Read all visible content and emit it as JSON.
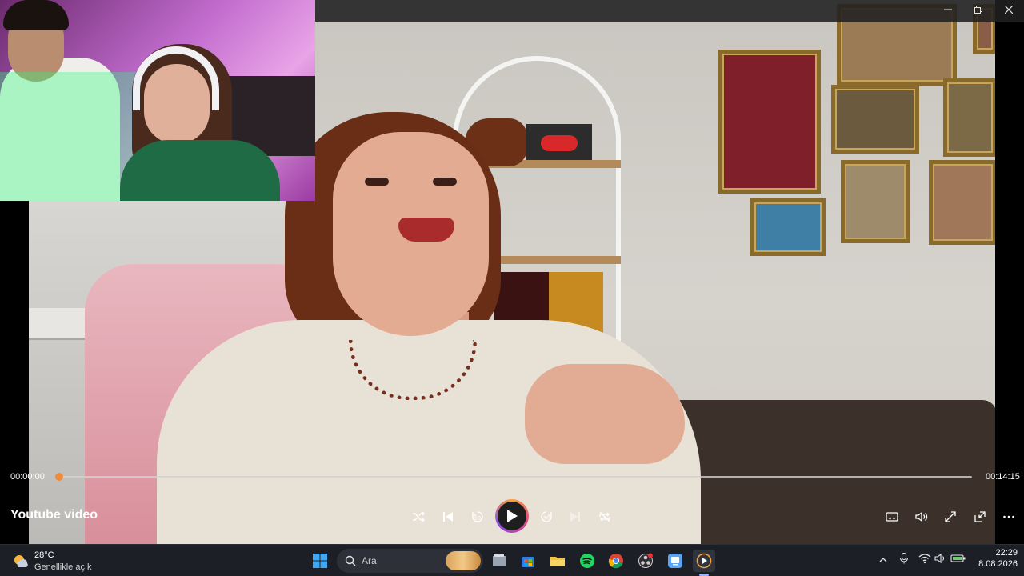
{
  "player": {
    "title": "Youtube video",
    "elapsed": "00:00:00",
    "duration": "00:14:15",
    "progress": 0.0,
    "accent_color": "#f08a3c",
    "controls": [
      "shuffle-icon",
      "previous-icon",
      "rewind-10-icon",
      "play-icon",
      "forward-30-icon",
      "next-icon",
      "repeat-icon"
    ],
    "right_controls": [
      "subtitles-icon",
      "volume-icon",
      "fullscreen-icon",
      "miniplayer-icon",
      "more-icon"
    ]
  },
  "window": {
    "buttons": [
      "minimize-icon",
      "restore-icon",
      "close-icon"
    ]
  },
  "taskbar": {
    "weather": {
      "temperature": "28°C",
      "condition": "Genellikle açık",
      "icon": "partly-sunny-icon"
    },
    "search": {
      "placeholder": "Ara"
    },
    "apps": [
      "windows-start-icon",
      "file-explorer-icon",
      "microsoft-store-icon",
      "folder-icon",
      "spotify-icon",
      "chrome-icon",
      "obs-icon",
      "remote-app-icon",
      "media-player-icon"
    ],
    "tray_icons": [
      "chevron-up-icon",
      "microphone-icon",
      "wifi-icon",
      "speaker-icon",
      "battery-icon"
    ],
    "time": "22:29",
    "date": "8.08.2026"
  }
}
